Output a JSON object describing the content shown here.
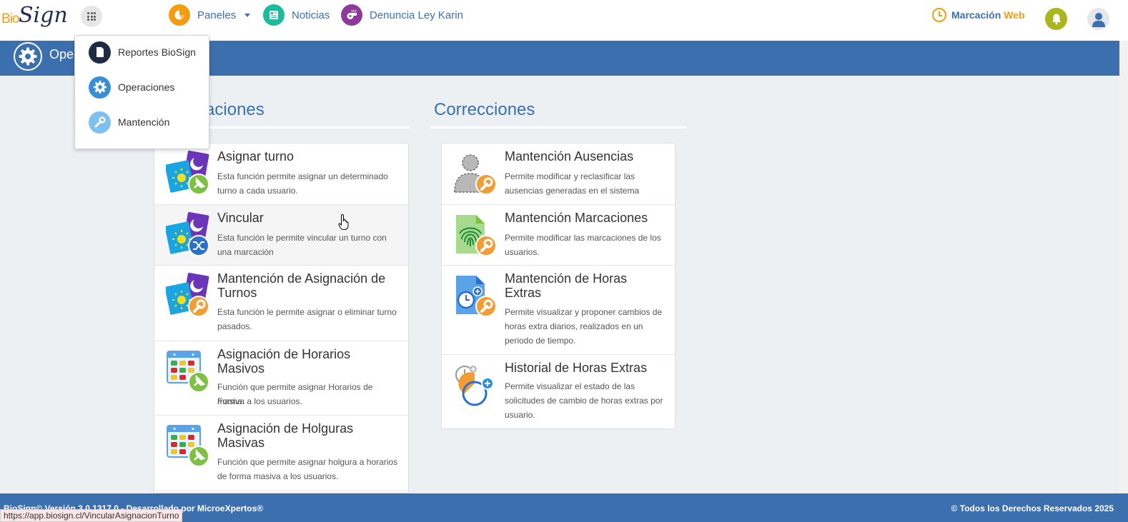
{
  "colors": {
    "brand_blue": "#3c6fad",
    "link_blue": "#3a6fb3",
    "orange": "#f39c12",
    "teal": "#1abc9c",
    "purple": "#8e3a9b",
    "bell_green": "#a9b71c"
  },
  "brand": {
    "logo_a": "Bio",
    "logo_b": "Sign"
  },
  "nav": {
    "apps_icon": "grid-icon",
    "items": [
      {
        "label": "Paneles",
        "icon": "pie-chart-icon",
        "has_dropdown": true
      },
      {
        "label": "Noticias",
        "icon": "newspaper-icon"
      },
      {
        "label": "Denuncia Ley Karin",
        "icon": "whistle-icon"
      }
    ],
    "marcacion_a": "Marcación",
    "marcacion_b": "Web"
  },
  "apps_menu": [
    {
      "label": "Reportes BioSign",
      "icon": "document-icon",
      "color": "#1f2a44"
    },
    {
      "label": "Operaciones",
      "icon": "gear-icon",
      "color": "#3a8ed6"
    },
    {
      "label": "Mantención",
      "icon": "wrench-icon",
      "color": "#7fc1ee"
    }
  ],
  "page": {
    "title": "Operaciones"
  },
  "sections": {
    "left_title": "Asignaciones",
    "right_title": "Correcciones"
  },
  "left_items": [
    {
      "title": "Asignar turno",
      "desc_1": "Esta función permite asignar un determinado",
      "desc_2": "turno a cada usuario."
    },
    {
      "title": "Vincular",
      "desc_1": "Esta función le permite vincular un turno con",
      "desc_2": "una marcación"
    },
    {
      "title_1": "Mantención de Asignación de",
      "title_2": "Turnos",
      "desc_1": "Esta función le permite asignar o eliminar turno",
      "desc_2": "pasados."
    },
    {
      "title_1": "Asignación de Horarios",
      "title_2": "Masivos",
      "desc_1": "Función que permite asignar Horarios de Forma",
      "desc_2": "masiva a los usuarios."
    },
    {
      "title_1": "Asignación de Holguras",
      "title_2": "Masivas",
      "desc_1": "Función que permite asignar holgura a horarios",
      "desc_2": "de forma masiva a los usuarios."
    }
  ],
  "right_items": [
    {
      "title": "Mantención Ausencias",
      "desc_1": "Permite modificar y reclasificar las",
      "desc_2": "ausencias generadas en el sistema"
    },
    {
      "title": "Mantención Marcaciones",
      "desc_1": "Permite modificar las marcaciones de los",
      "desc_2": "usuarios."
    },
    {
      "title_1": "Mantención de Horas",
      "title_2": "Extras",
      "desc_1": "Permite visualizar y proponer cambios de",
      "desc_2": "horas extra diarios, realizados en un",
      "desc_3": "periodo de tiempo."
    },
    {
      "title": "Historial de Horas Extras",
      "desc_1": "Permite visualizar el estado de las",
      "desc_2": "solicitudes de cambio de horas extras por",
      "desc_3": "usuario."
    }
  ],
  "footer": {
    "left": "BioSign© Versión 3.0.1317.0 - Desarrollado por MicroeXpertos®",
    "right": "© Todos los Derechos Reservados 2025"
  },
  "status_url": "https://app.biosign.cl/VincularAsignacionTurno"
}
